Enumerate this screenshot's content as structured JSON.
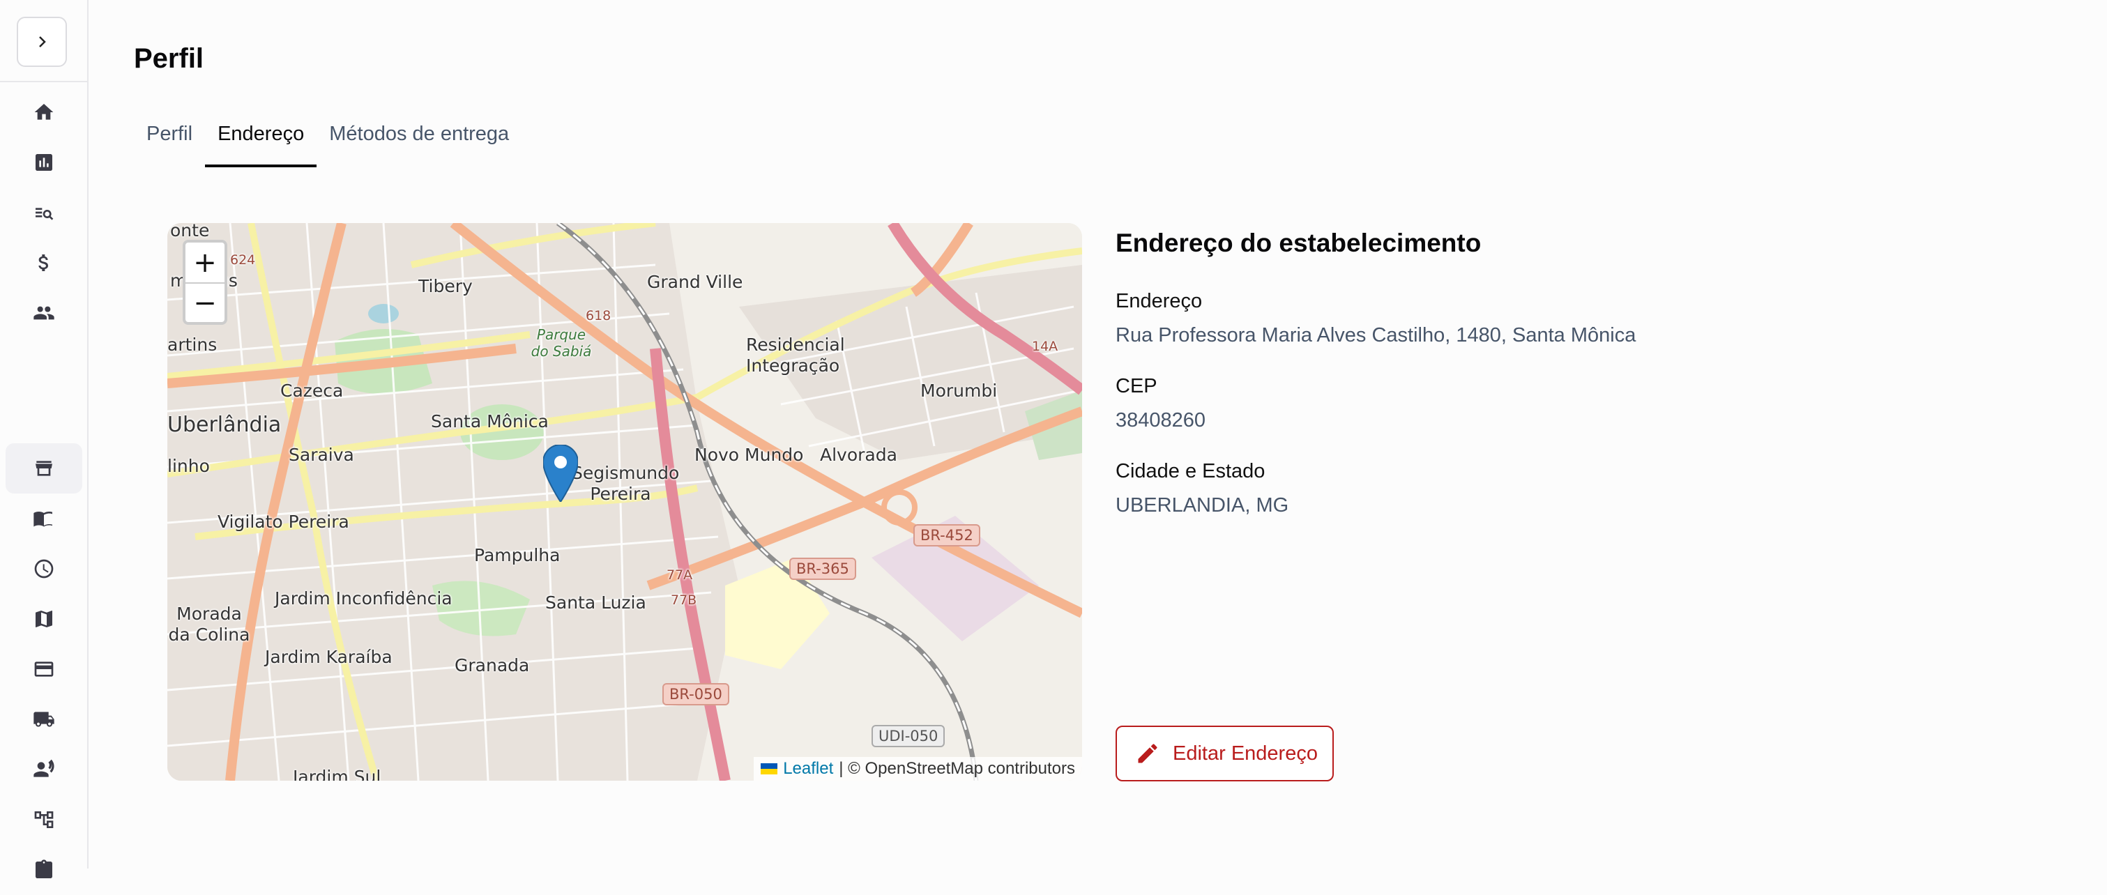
{
  "sidebar": {
    "toggle_icon": "chevron-right-icon",
    "items": [
      {
        "icon": "home-icon"
      },
      {
        "icon": "board-icon"
      },
      {
        "icon": "search-list-icon"
      },
      {
        "icon": "dollar-icon"
      },
      {
        "icon": "users-icon"
      },
      {
        "icon": "store-icon",
        "active": true
      },
      {
        "icon": "menu-book-icon"
      },
      {
        "icon": "clock-icon"
      },
      {
        "icon": "map-icon"
      },
      {
        "icon": "credit-card-icon"
      },
      {
        "icon": "truck-icon"
      },
      {
        "icon": "group-icon"
      },
      {
        "icon": "hierarchy-icon"
      },
      {
        "icon": "clipboard-icon"
      }
    ]
  },
  "page": {
    "title": "Perfil",
    "tabs": [
      {
        "label": "Perfil"
      },
      {
        "label": "Endereço",
        "active": true
      },
      {
        "label": "Métodos de entrega"
      }
    ]
  },
  "map": {
    "zoom_in": "+",
    "zoom_out": "−",
    "attribution_link": "Leaflet",
    "attribution_text": "| © OpenStreetMap contributors",
    "labels": {
      "onte": "onte",
      "jesus": "m Jesus",
      "tibery": "Tibery",
      "grandville": "Grand Ville",
      "parque": "Parque do Sabiá",
      "residencial": "Residencial Integração",
      "morumbi": "Morumbi",
      "artins": "artins",
      "cazeca": "Cazeca",
      "uberlandia": "Uberlândia",
      "santamonica": "Santa Mônica",
      "linho": "linho",
      "saraiva": "Saraiva",
      "segismundo": "Segismundo Pereira",
      "novomundo": "Novo Mundo",
      "alvorada": "Alvorada",
      "vigilato": "Vigilato Pereira",
      "pampulha": "Pampulha",
      "inconfidencia": "Jardim Inconfidência",
      "santaluzia": "Santa Luzia",
      "morada": "Morada da Colina",
      "karaiba": "Jardim Karaíba",
      "granada": "Granada",
      "sul": "Jardim Sul",
      "r618": "618",
      "r624": "624",
      "r14a": "14A",
      "r77a": "77A",
      "r77b": "77B"
    },
    "shields": {
      "br452": "BR-452",
      "br365": "BR-365",
      "br050": "BR-050",
      "udi050": "UDI-050"
    }
  },
  "address": {
    "section_title": "Endereço do estabelecimento",
    "street_label": "Endereço",
    "street_value": "Rua Professora Maria Alves Castilho, 1480, Santa Mônica",
    "cep_label": "CEP",
    "cep_value": "38408260",
    "city_label": "Cidade e Estado",
    "city_value": "UBERLANDIA, MG",
    "edit_button": "Editar Endereço"
  },
  "colors": {
    "accent_red": "#b91c1c",
    "text_muted": "#475569"
  }
}
